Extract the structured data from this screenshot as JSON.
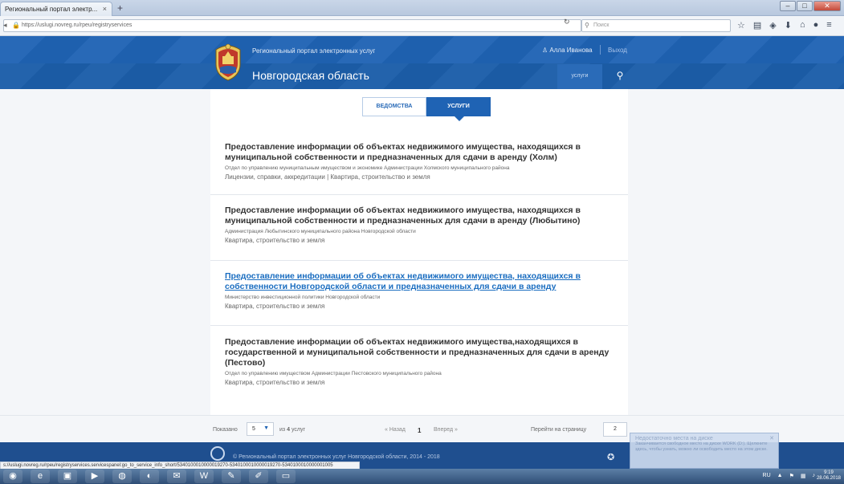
{
  "browser": {
    "tab_title": "Региональный портал электр...",
    "tab_close": "×",
    "new_tab": "+",
    "url": "https://uslugi.novreg.ru/rpeu/registryservices",
    "search_placeholder": "Поиск",
    "status_url": "s://uslugi.novreg.ru/rpeu/registryservices.servicespanel:go_to_service_info_short/5340100010000019270-5340100010000019270-5340100010000001005"
  },
  "header": {
    "portal_title": "Региональный портал электронных услуг",
    "user_name": "Алла Иванова",
    "logout": "Выход",
    "region": "Новгородская область",
    "nav_services": "услуги"
  },
  "toggle": {
    "departments": "ВЕДОМСТВА",
    "services": "УСЛУГИ"
  },
  "services": [
    {
      "title": "Предоставление информации об объектах недвижимого имущества, находящихся в муниципальной собственности и предназначенных для сдачи в аренду (Холм)",
      "department": "Отдел по управлению муниципальным имуществом и экономике Администрации Холмского муниципального района",
      "categories": "Лицензии, справки, аккредитации | Квартира, строительство и земля"
    },
    {
      "title": "Предоставление информации об объектах недвижимого имущества, находящихся в муниципальной собственности и предназначенных для сдачи в аренду (Любытино)",
      "department": "Администрация Любытинского муниципального района Новгородской области",
      "categories": "Квартира, строительство и земля"
    },
    {
      "title": "Предоставление информации об объектах недвижимого имущества, находящихся в собственности Новгородской области и предназначенных для сдачи в аренду",
      "department": "Министерство инвестиционной политики Новгородской области",
      "categories": "Квартира, строительство и земля"
    },
    {
      "title": "Предоставление информации об объектах недвижимого имущества,находящихся в государственной и муниципальной собственности и предназначенных для сдачи в аренду (Пестово)",
      "department": "Отдел по управлению имуществом Администрации Пестовского муниципального района",
      "categories": "Квартира, строительство и земля"
    }
  ],
  "pagination": {
    "shown_label": "Показано",
    "page_size": "5",
    "of_label": "из",
    "total": "4",
    "total_suffix": "услуг",
    "prev": "« Назад",
    "current": "1",
    "next": "Вперед »",
    "goto_label": "Перейти на страницу",
    "goto_value": "2"
  },
  "footer": {
    "copyright": "© Региональный портал электронных услуг Новгородской области, 2014 - 2018"
  },
  "notification": {
    "title": "Недостаточно места на диске",
    "text": "Заканчивается свободное место на диске WORK (D:). Щелкните здесь, чтобы узнать, можно ли освободить место на этом диске."
  },
  "taskbar": {
    "lang": "RU",
    "time": "9:19",
    "date": "28.06.2018"
  }
}
